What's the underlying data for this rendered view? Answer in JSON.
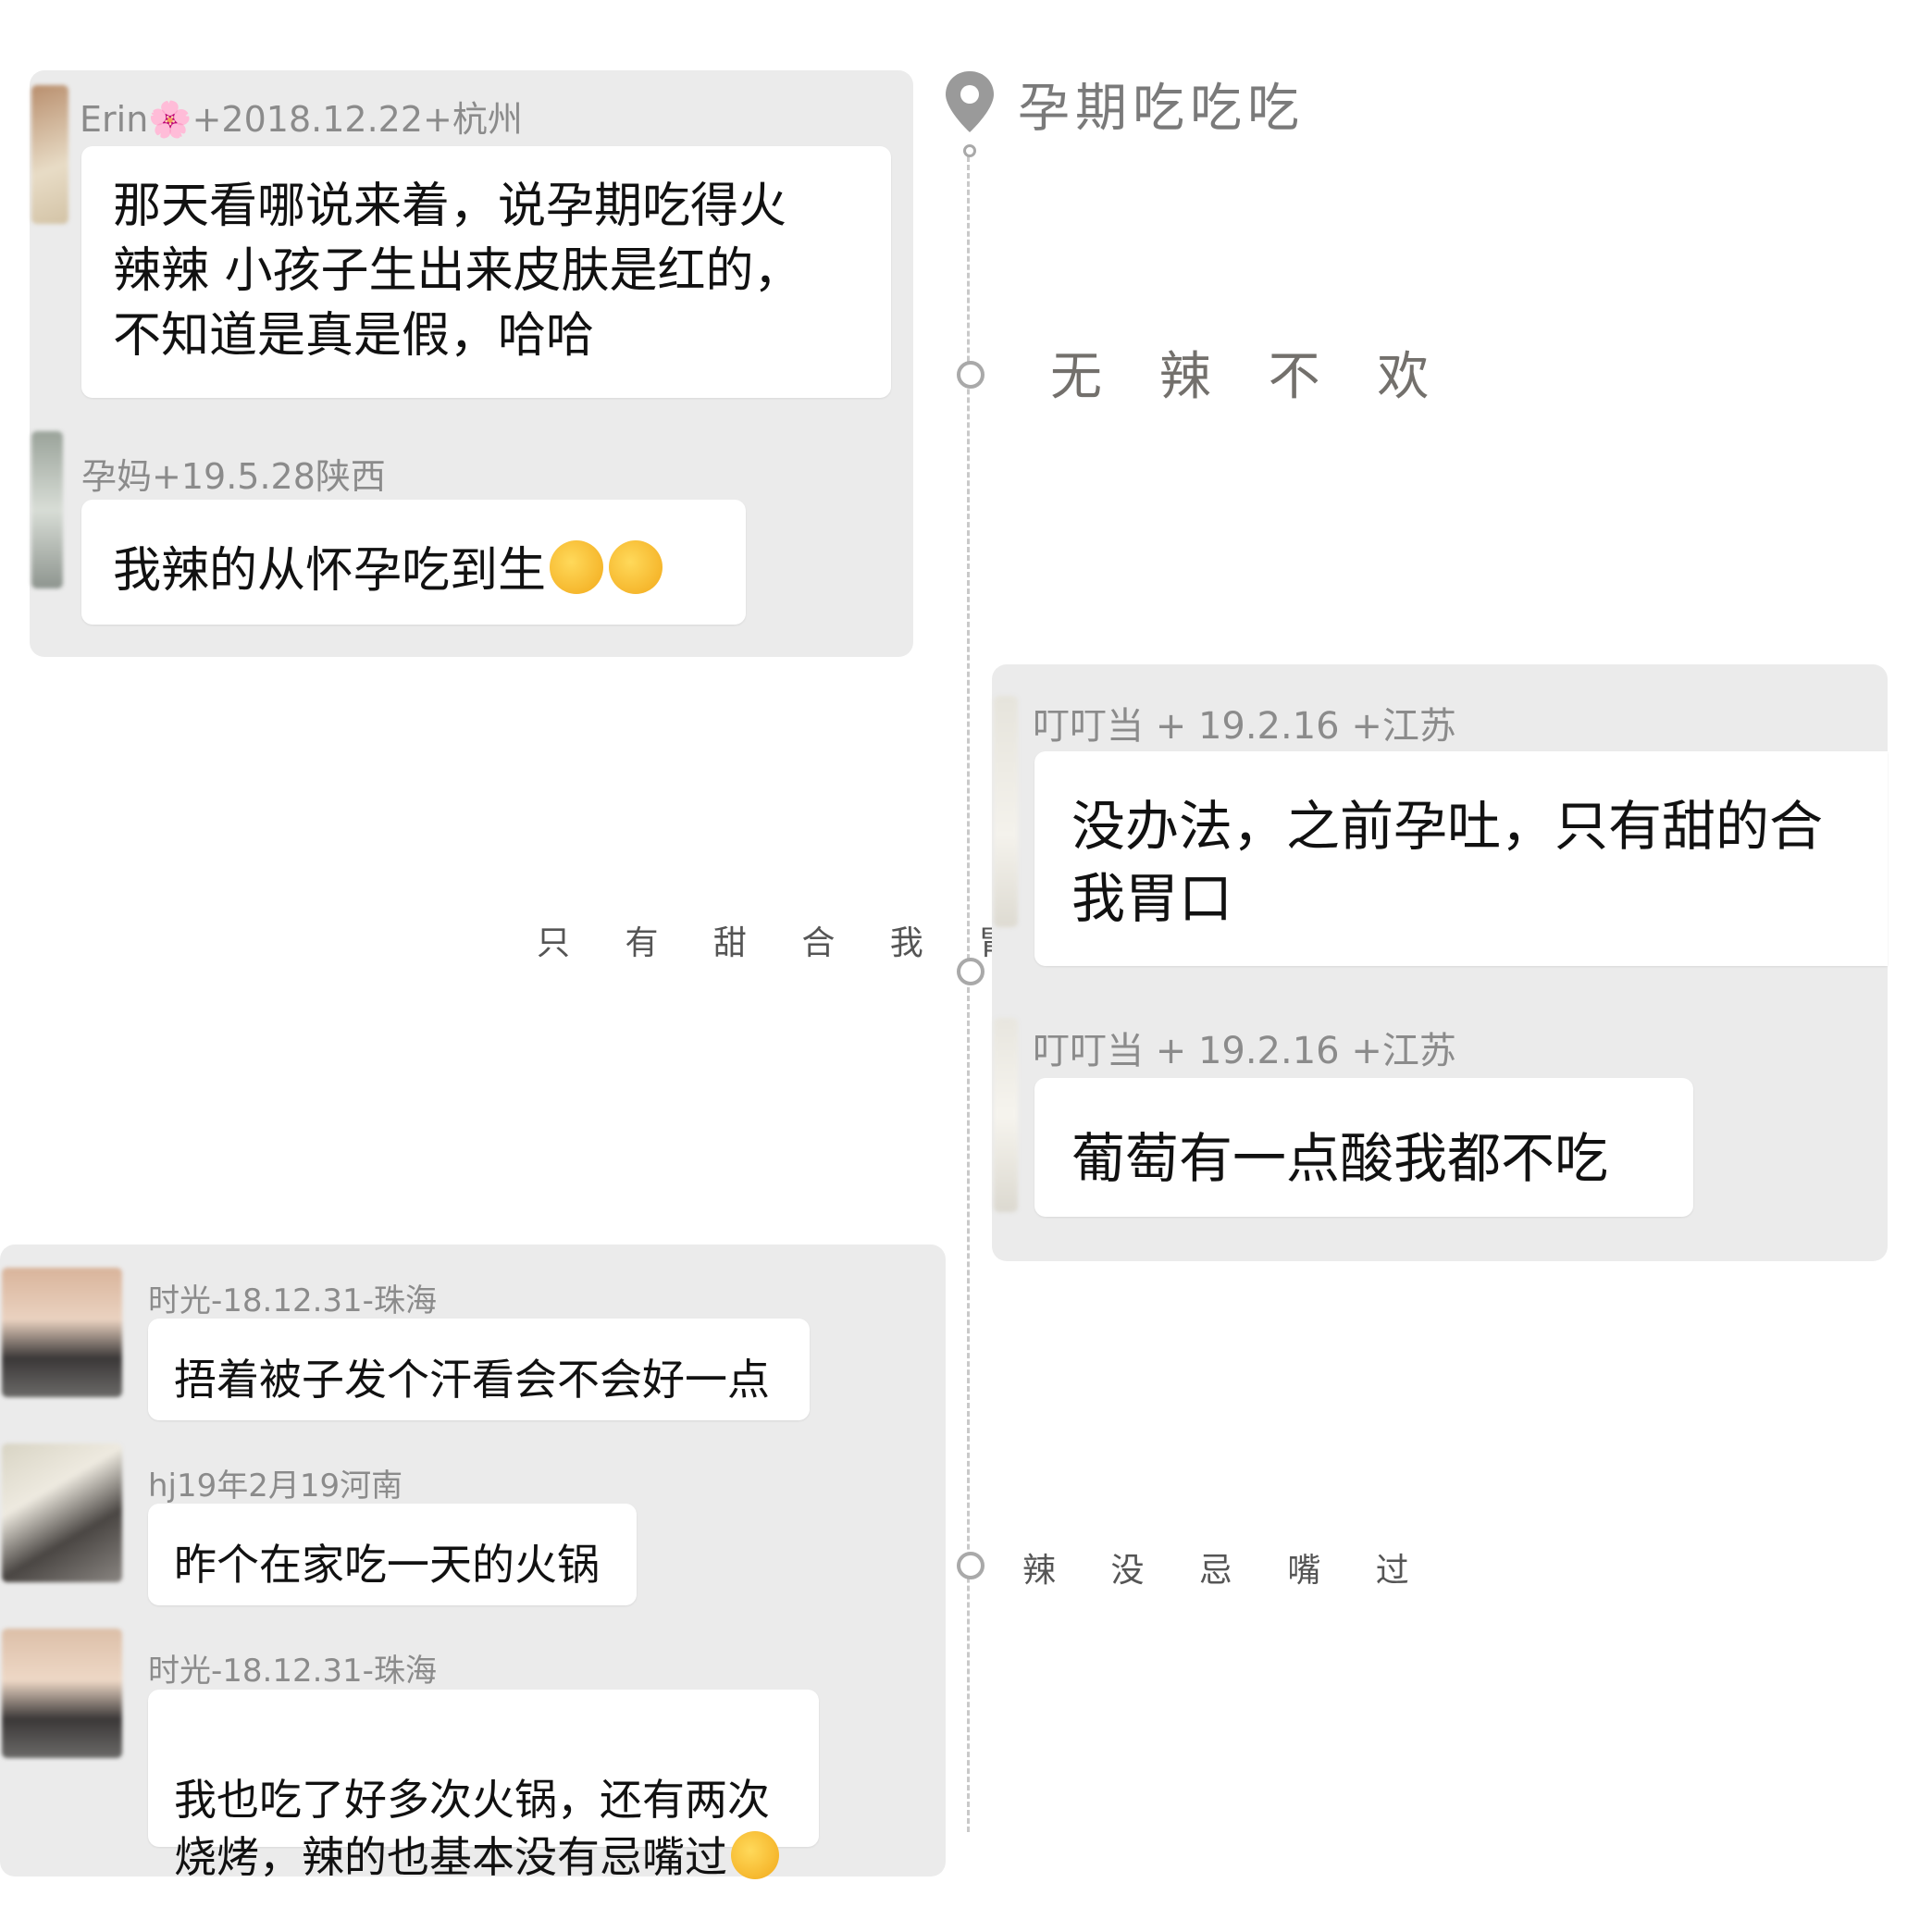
{
  "header": {
    "title": "孕期吃吃吃",
    "pin_icon": "location-pin-icon"
  },
  "timeline": {
    "tags": [
      "无 辣 不 欢",
      "只 有 甜 合 我 胃 口",
      "辣 没 忌 嘴 过"
    ]
  },
  "groups": [
    {
      "comments": [
        {
          "meta": "Erin🌸+2018.12.22+杭州",
          "text": "那天看哪说来着，说孕期吃得火\n辣辣 小孩子生出来皮肤是红的，\n不知道是真是假，哈哈"
        },
        {
          "meta": "孕妈+19.5.28陕西",
          "text": "我辣的从怀孕吃到生",
          "emoji": "face-palm-laugh-emoji"
        }
      ]
    },
    {
      "comments": [
        {
          "meta": "叮叮当 + 19.2.16 +江苏",
          "text": "没办法，之前孕吐，只有甜的合\n我胃口"
        },
        {
          "meta": "叮叮当 + 19.2.16 +江苏",
          "text": "葡萄有一点酸我都不吃"
        }
      ]
    },
    {
      "comments": [
        {
          "meta": "时光-18.12.31-珠海",
          "text": "捂着被子发个汗看会不会好一点"
        },
        {
          "meta": "hj19年2月19河南",
          "text": "昨个在家吃一天的火锅"
        },
        {
          "meta": "时光-18.12.31-珠海",
          "text": "我也吃了好多次火锅，还有两次\n烧烤，辣的也基本没有忌嘴过",
          "emoji": "face-palm-laugh-emoji"
        }
      ]
    }
  ]
}
